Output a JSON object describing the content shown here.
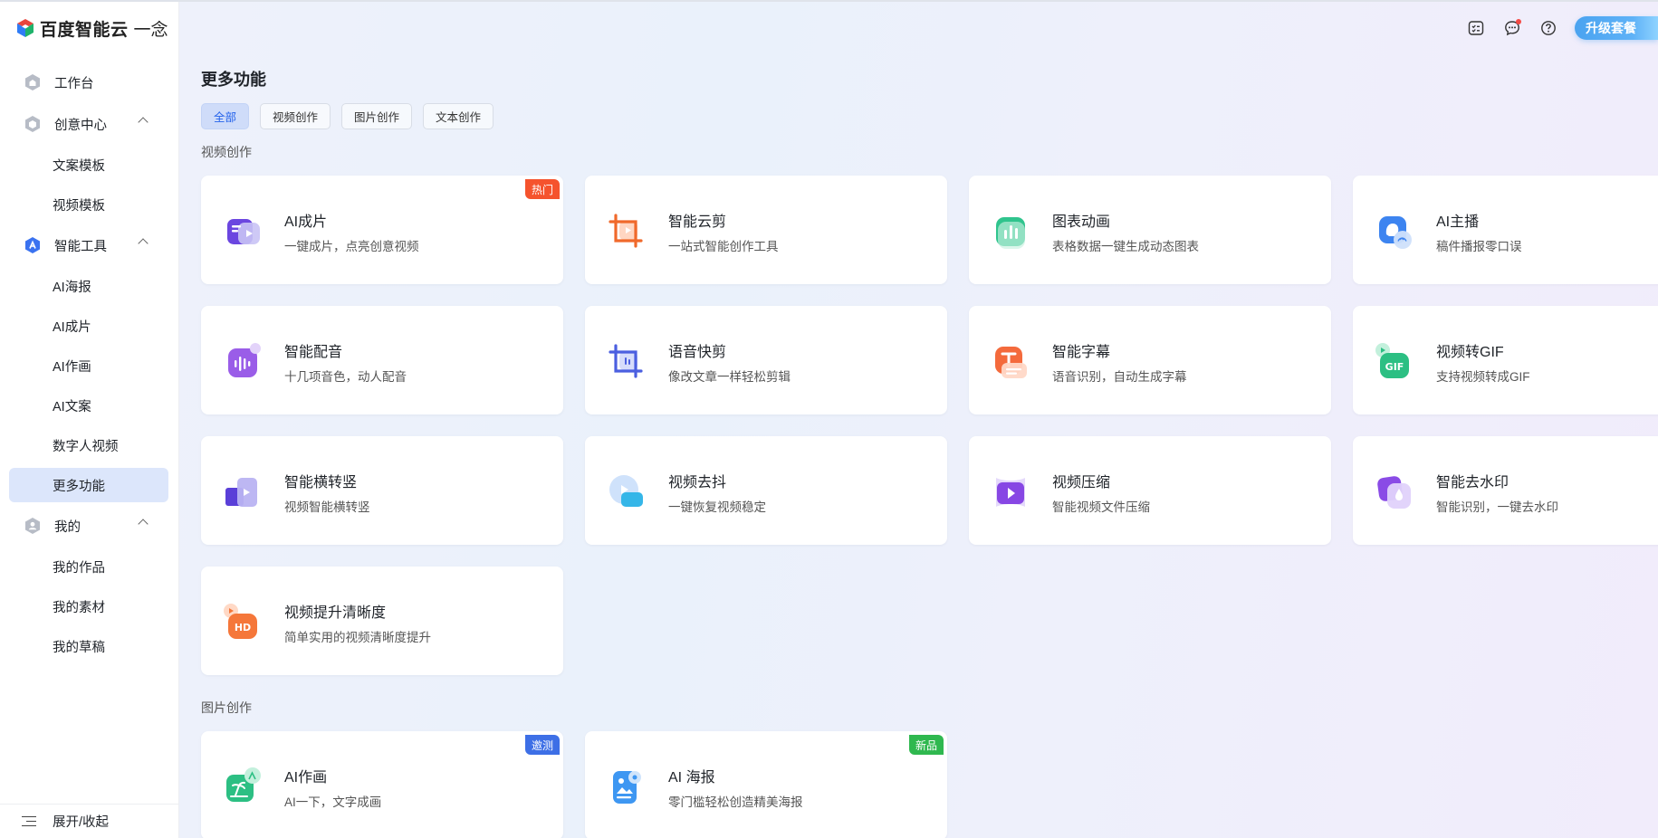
{
  "brand": {
    "name": "百度智能云",
    "product": "一念"
  },
  "sidebar": {
    "groups": [
      {
        "label": "工作台",
        "items": []
      },
      {
        "label": "创意中心",
        "items": [
          "文案模板",
          "视频模板"
        ]
      },
      {
        "label": "智能工具",
        "items": [
          "AI海报",
          "AI成片",
          "AI作画",
          "AI文案",
          "数字人视频",
          "更多功能"
        ]
      },
      {
        "label": "我的",
        "items": [
          "我的作品",
          "我的素材",
          "我的草稿"
        ]
      }
    ],
    "active_item": "更多功能",
    "footer": "展开/收起"
  },
  "header": {
    "upgrade_label": "升级套餐"
  },
  "main": {
    "title": "更多功能",
    "filters": [
      "全部",
      "视频创作",
      "图片创作",
      "文本创作"
    ],
    "active_filter": "全部",
    "sections": [
      {
        "title": "视频创作",
        "cards": [
          {
            "name": "AI成片",
            "desc": "一键成片，点亮创意视频",
            "badge": "热门",
            "badge_color": "#f5532d",
            "icon": "ai-film-icon"
          },
          {
            "name": "智能云剪",
            "desc": "一站式智能创作工具",
            "icon": "crop-edit-icon"
          },
          {
            "name": "图表动画",
            "desc": "表格数据一键生成动态图表",
            "icon": "chart-animation-icon"
          },
          {
            "name": "AI主播",
            "desc": "稿件播报零口误",
            "icon": "ai-anchor-icon"
          },
          {
            "name": "智能配音",
            "desc": "十几项音色，动人配音",
            "icon": "voice-dub-icon"
          },
          {
            "name": "语音快剪",
            "desc": "像改文章一样轻松剪辑",
            "icon": "voice-cut-icon"
          },
          {
            "name": "智能字幕",
            "desc": "语音识别，自动生成字幕",
            "icon": "subtitle-icon"
          },
          {
            "name": "视频转GIF",
            "desc": "支持视频转成GIF",
            "icon": "gif-icon"
          },
          {
            "name": "智能横转竖",
            "desc": "视频智能横转竖",
            "icon": "rotate-video-icon"
          },
          {
            "name": "视频去抖",
            "desc": "一键恢复视频稳定",
            "icon": "stabilize-icon"
          },
          {
            "name": "视频压缩",
            "desc": "智能视频文件压缩",
            "icon": "compress-icon"
          },
          {
            "name": "智能去水印",
            "desc": "智能识别，一键去水印",
            "icon": "watermark-remove-icon"
          },
          {
            "name": "视频提升清晰度",
            "desc": "简单实用的视频清晰度提升",
            "icon": "hd-icon"
          }
        ]
      },
      {
        "title": "图片创作",
        "cards": [
          {
            "name": "AI作画",
            "desc": "AI一下，文字成画",
            "badge": "邀测",
            "badge_color": "#3d6fe6",
            "icon": "ai-painting-icon"
          },
          {
            "name": "AI 海报",
            "desc": "零门槛轻松创造精美海报",
            "badge": "新品",
            "badge_color": "#2fb84f",
            "icon": "ai-poster-icon"
          }
        ]
      }
    ]
  }
}
